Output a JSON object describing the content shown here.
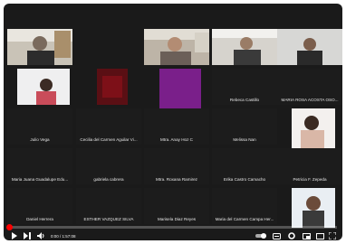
{
  "player": {
    "time_display": "0:00 / 1:57:08",
    "progress": 0.0
  },
  "participants": [
    {
      "id": "p1",
      "name": ""
    },
    {
      "id": "p2",
      "name": ""
    },
    {
      "id": "p3",
      "name": ""
    },
    {
      "id": "p4",
      "name": ""
    },
    {
      "id": "p5",
      "name": ""
    },
    {
      "id": "p6",
      "name": ""
    },
    {
      "id": "p7",
      "name": ""
    },
    {
      "id": "p8",
      "name": "Rebeca Castillo"
    },
    {
      "id": "p9",
      "name": "MARIA ROSA ACOSTA OSO..."
    },
    {
      "id": "p10",
      "name": "Julio Vega"
    },
    {
      "id": "p11",
      "name": "Cecilia del Carmen Aguilar Vi..."
    },
    {
      "id": "p12",
      "name": "Mtra. Anay Hoz C"
    },
    {
      "id": "p13",
      "name": "Melissa Nan"
    },
    {
      "id": "p14",
      "name": "Maria Juana Guadalupe Edu..."
    },
    {
      "id": "p15",
      "name": "gabriela cabrera"
    },
    {
      "id": "p16",
      "name": "Mtra. Roxana Ramirez"
    },
    {
      "id": "p17",
      "name": "Erika Castro Camacho"
    },
    {
      "id": "p18",
      "name": "Petricia F. Zepeda"
    },
    {
      "id": "p19",
      "name": "Daniel Herrera"
    },
    {
      "id": "p20",
      "name": "ESTHER VAZQUEZ SILVA"
    },
    {
      "id": "p21",
      "name": "Marisela Diaz Reyes"
    },
    {
      "id": "p22",
      "name": "Maria del Carmen Campa Her..."
    },
    {
      "id": "p23",
      "name": ""
    }
  ],
  "colors": {
    "progress": "#ff0000",
    "tile_purple": "#7a1f8a",
    "tile_maroon": "#5a0f14"
  },
  "icons": [
    "play-icon",
    "next-icon",
    "volume-icon",
    "autoplay-toggle-icon",
    "subtitles-icon",
    "settings-icon",
    "miniplayer-icon",
    "theater-icon",
    "fullscreen-icon"
  ]
}
